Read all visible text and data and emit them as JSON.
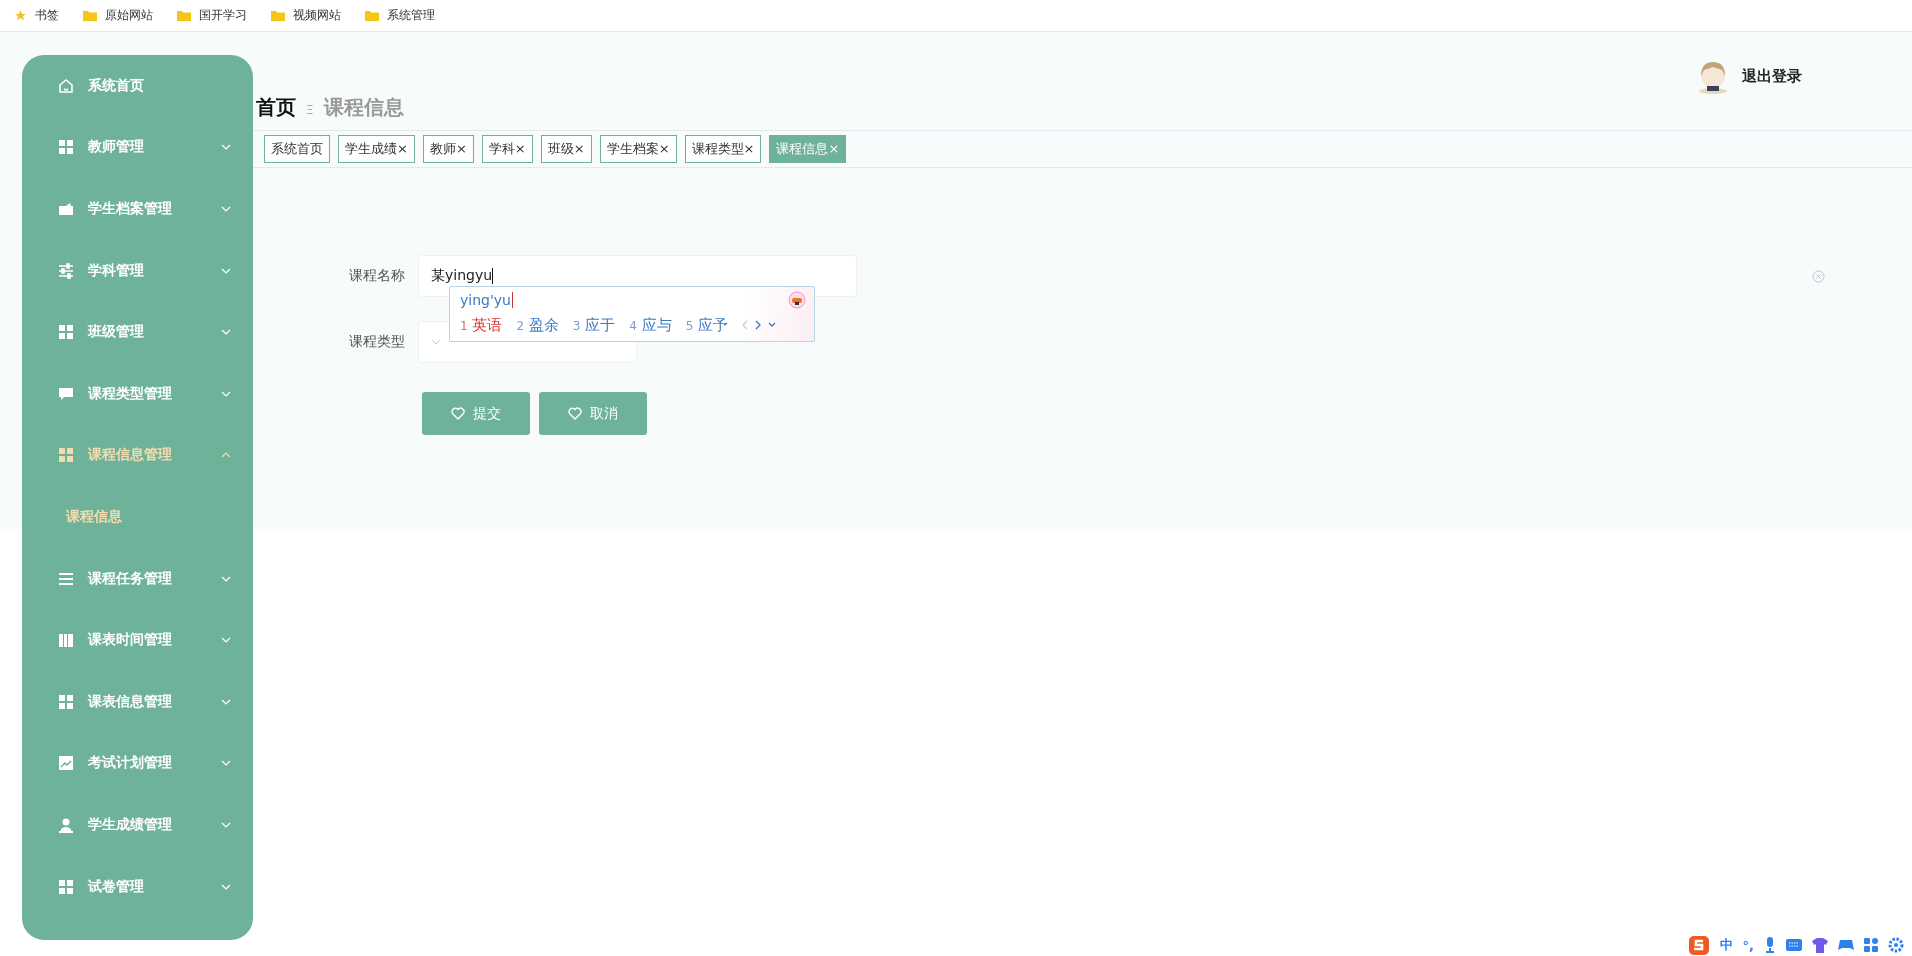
{
  "bookmarks": [
    {
      "label": "书签",
      "kind": "star"
    },
    {
      "label": "原始网站",
      "kind": "folder"
    },
    {
      "label": "国开学习",
      "kind": "folder"
    },
    {
      "label": "视频网站",
      "kind": "folder"
    },
    {
      "label": "系统管理",
      "kind": "folder"
    }
  ],
  "sidebar": {
    "items": [
      {
        "label": "系统首页",
        "kind": "home",
        "selected": false
      },
      {
        "label": "教师管理",
        "kind": "grid",
        "expanded": false,
        "selected": false
      },
      {
        "label": "学生档案管理",
        "kind": "wallet",
        "expanded": false,
        "selected": false
      },
      {
        "label": "学科管理",
        "kind": "sliders",
        "expanded": false,
        "selected": false
      },
      {
        "label": "班级管理",
        "kind": "grid",
        "expanded": false,
        "selected": false
      },
      {
        "label": "课程类型管理",
        "kind": "chat",
        "expanded": false,
        "selected": false
      },
      {
        "label": "课程信息管理",
        "kind": "grid",
        "expanded": true,
        "selected": true,
        "children": [
          {
            "label": "课程信息",
            "selected": true
          }
        ]
      },
      {
        "label": "课程任务管理",
        "kind": "list",
        "expanded": false,
        "selected": false
      },
      {
        "label": "课表时间管理",
        "kind": "book",
        "expanded": false,
        "selected": false
      },
      {
        "label": "课表信息管理",
        "kind": "grid",
        "expanded": false,
        "selected": false
      },
      {
        "label": "考试计划管理",
        "kind": "chart",
        "expanded": false,
        "selected": false
      },
      {
        "label": "学生成绩管理",
        "kind": "user",
        "expanded": false,
        "selected": false
      },
      {
        "label": "试卷管理",
        "kind": "grid",
        "expanded": false,
        "selected": false
      }
    ]
  },
  "breadcrumb": {
    "items": [
      "首页",
      "课程信息"
    ],
    "separator": "Ξ"
  },
  "header": {
    "logout": "退出登录"
  },
  "tabs": [
    {
      "label": "系统首页",
      "selected": false
    },
    {
      "label": "学生成绩",
      "close": "×",
      "selected": false
    },
    {
      "label": "教师",
      "close": "×",
      "selected": false
    },
    {
      "label": "学科",
      "close": "×",
      "selected": false
    },
    {
      "label": "班级",
      "close": "×",
      "selected": false
    },
    {
      "label": "学生档案",
      "close": "×",
      "selected": false
    },
    {
      "label": "课程类型",
      "close": "×",
      "selected": false
    },
    {
      "label": "课程信息",
      "close": "×",
      "selected": true
    }
  ],
  "form": {
    "fields": [
      {
        "label": "课程名称",
        "kind": "input",
        "value": "某yingyu"
      },
      {
        "label": "课程类型",
        "kind": "select"
      }
    ],
    "buttons": [
      "提交",
      "取消"
    ]
  },
  "ime": {
    "composition": "ying'yu",
    "candidates": [
      {
        "index": "1",
        "text": "英语",
        "selected": true
      },
      {
        "index": "2",
        "text": "盈余",
        "selected": false
      },
      {
        "index": "3",
        "text": "应于",
        "selected": false
      },
      {
        "index": "4",
        "text": "应与",
        "selected": false
      },
      {
        "index": "5",
        "text": "应予",
        "selected": false
      }
    ]
  },
  "tray": {
    "mode": "中",
    "punct": "°,"
  }
}
